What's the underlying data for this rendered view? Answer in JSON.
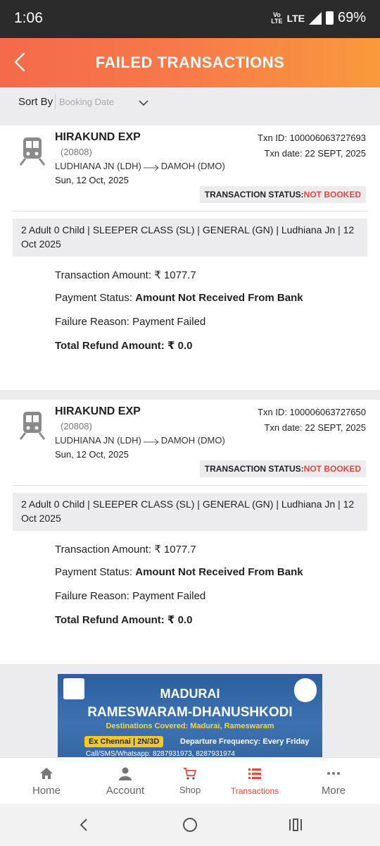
{
  "status_bar": {
    "time": "1:06",
    "volte_top": "Vo",
    "volte_bottom": "LTE",
    "network": "LTE",
    "battery": "69%"
  },
  "header": {
    "title": "FAILED TRANSACTIONS"
  },
  "sort": {
    "label": "Sort By",
    "value": "Booking Date"
  },
  "transactions": [
    {
      "train_name": "HIRAKUND EXP",
      "train_number": "(20808)",
      "from": "LUDHIANA JN (LDH)",
      "to": "DAMOH (DMO)",
      "journey_date": "Sun, 12 Oct, 2025",
      "txn_id": "Txn ID: 100006063727693",
      "txn_date": "Txn date: 22 SEPT, 2025",
      "status_label": "TRANSACTION STATUS:",
      "status_value": "NOT BOOKED",
      "summary": "2 Adult 0 Child  | SLEEPER CLASS (SL) | GENERAL (GN) | Ludhiana Jn | 12 Oct 2025",
      "amount_label": "Transaction Amount:",
      "amount_value": "₹  1077.7",
      "payment_label": "Payment Status:",
      "payment_value": "Amount Not Received From Bank",
      "failure_label": "Failure Reason:",
      "failure_value": "Payment Failed",
      "refund_label": "Total Refund Amount:",
      "refund_value": "₹ 0.0"
    },
    {
      "train_name": "HIRAKUND EXP",
      "train_number": "(20808)",
      "from": "LUDHIANA JN (LDH)",
      "to": "DAMOH (DMO)",
      "journey_date": "Sun, 12 Oct, 2025",
      "txn_id": "Txn ID: 100006063727650",
      "txn_date": "Txn date: 22 SEPT, 2025",
      "status_label": "TRANSACTION STATUS:",
      "status_value": "NOT BOOKED",
      "summary": "2 Adult 0 Child  | SLEEPER CLASS (SL) | GENERAL (GN) | Ludhiana Jn | 12 Oct 2025",
      "amount_label": "Transaction Amount:",
      "amount_value": "₹  1077.7",
      "payment_label": "Payment Status:",
      "payment_value": "Amount Not Received From Bank",
      "failure_label": "Failure Reason:",
      "failure_value": "Payment Failed",
      "refund_label": "Total Refund Amount:",
      "refund_value": "₹ 0.0"
    }
  ],
  "banner": {
    "line1": "MADURAI",
    "line2": "RAMESWARAM-DHANUSHKODI",
    "line3": "Destinations Covered: Madurai, Rameswaram",
    "pill": "Ex Chennai | 2N/3D",
    "frequency": "Departure Frequency: Every Friday",
    "call": "Call/SMS/Whatsapp: 8287931973, 8287931974"
  },
  "bottom_nav": [
    {
      "label": "Home",
      "icon": "home-icon"
    },
    {
      "label": "Account",
      "icon": "person-icon"
    },
    {
      "label": "Shop",
      "icon": "cart-icon"
    },
    {
      "label": "Transactions",
      "icon": "list-icon",
      "active": true
    },
    {
      "label": "More",
      "icon": "more-dots-icon"
    }
  ],
  "colors": {
    "accent": "#e8453c",
    "header_start": "#f46a4a",
    "header_end": "#f99a3c"
  }
}
